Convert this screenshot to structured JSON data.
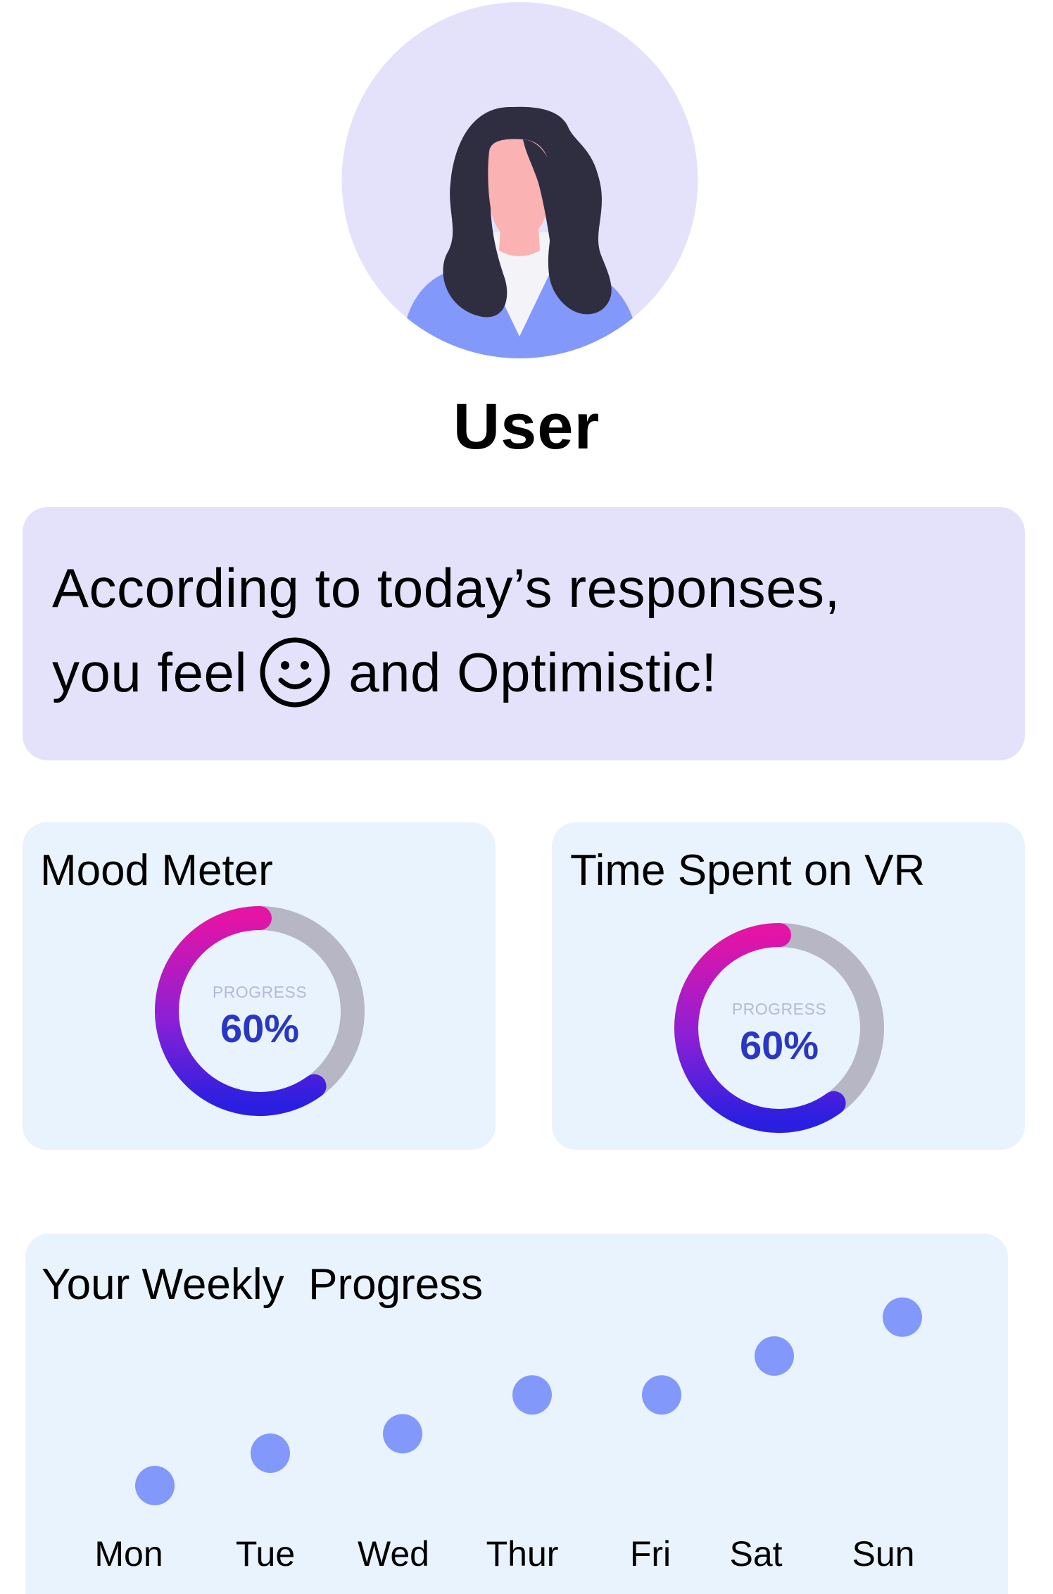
{
  "user": {
    "name": "User"
  },
  "mood_message": {
    "line1": "According to today’s responses,",
    "line2_prefix": "you feel",
    "mood_icon": "smiley-face-icon",
    "line2_suffix": "and Optimistic!"
  },
  "metrics": [
    {
      "title": "Mood Meter",
      "label": "PROGRESS",
      "value_text": "60%",
      "progress": 0.6
    },
    {
      "title": "Time Spent on VR",
      "label": "PROGRESS",
      "value_text": "60%",
      "progress": 0.6
    }
  ],
  "weekly": {
    "title": "Your Weekly  Progress"
  },
  "colors": {
    "accent_dot": "#8398fb",
    "card_bg": "#e9f3fd",
    "mood_bg": "#e4e2fb",
    "gauge_track": "#b6b6c5",
    "gauge_start": "#e314a6",
    "gauge_end": "#2a1fe0",
    "value_text": "#2a36c4"
  },
  "chart_data": {
    "type": "scatter",
    "title": "Your Weekly  Progress",
    "categories": [
      "Mon",
      "Tue",
      "Wed",
      "Thur",
      "Fri",
      "Sat",
      "Sun"
    ],
    "values": [
      1,
      1.5,
      1.8,
      2.4,
      2.4,
      3.0,
      3.6
    ],
    "xlabel": "",
    "ylabel": "",
    "ylim": [
      0,
      4
    ],
    "grid": false
  }
}
